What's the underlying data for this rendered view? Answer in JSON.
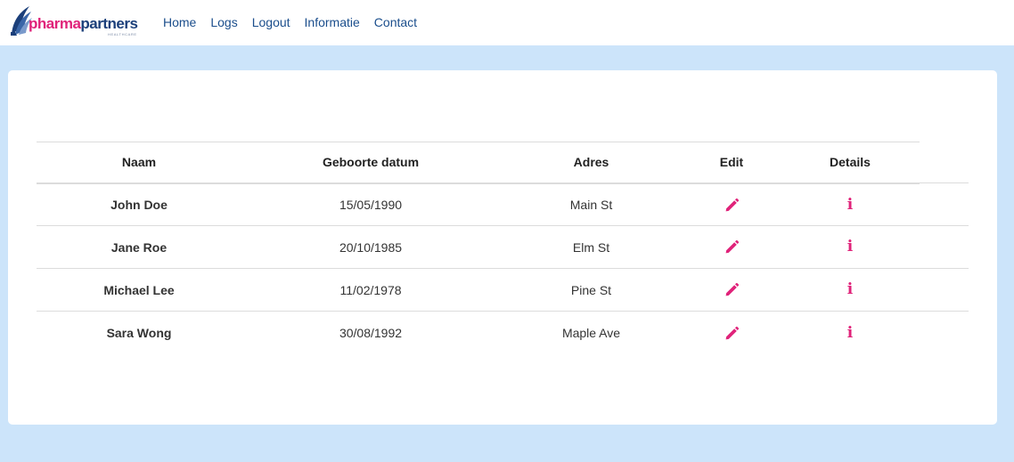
{
  "brand": {
    "name_part1": "pharma",
    "name_part2": "partners",
    "tagline": "HEALTHCARE"
  },
  "nav": {
    "links": [
      "Home",
      "Logs",
      "Logout",
      "Informatie",
      "Contact"
    ]
  },
  "table": {
    "headers": [
      "Naam",
      "Geboorte datum",
      "Adres",
      "Edit",
      "Details"
    ],
    "rows": [
      {
        "name": "John Doe",
        "birthdate": "15/05/1990",
        "address": "Main St"
      },
      {
        "name": "Jane Roe",
        "birthdate": "20/10/1985",
        "address": "Elm St"
      },
      {
        "name": "Michael Lee",
        "birthdate": "11/02/1978",
        "address": "Pine St"
      },
      {
        "name": "Sara Wong",
        "birthdate": "30/08/1992",
        "address": "Maple Ave"
      }
    ],
    "edit_icon": "pencil-icon",
    "details_icon": "info-icon",
    "details_glyph": "i"
  },
  "colors": {
    "background": "#cce4fa",
    "accent": "#e0237a",
    "nav_link": "#1b4e8c",
    "brand_blue": "#1b3f7a"
  }
}
